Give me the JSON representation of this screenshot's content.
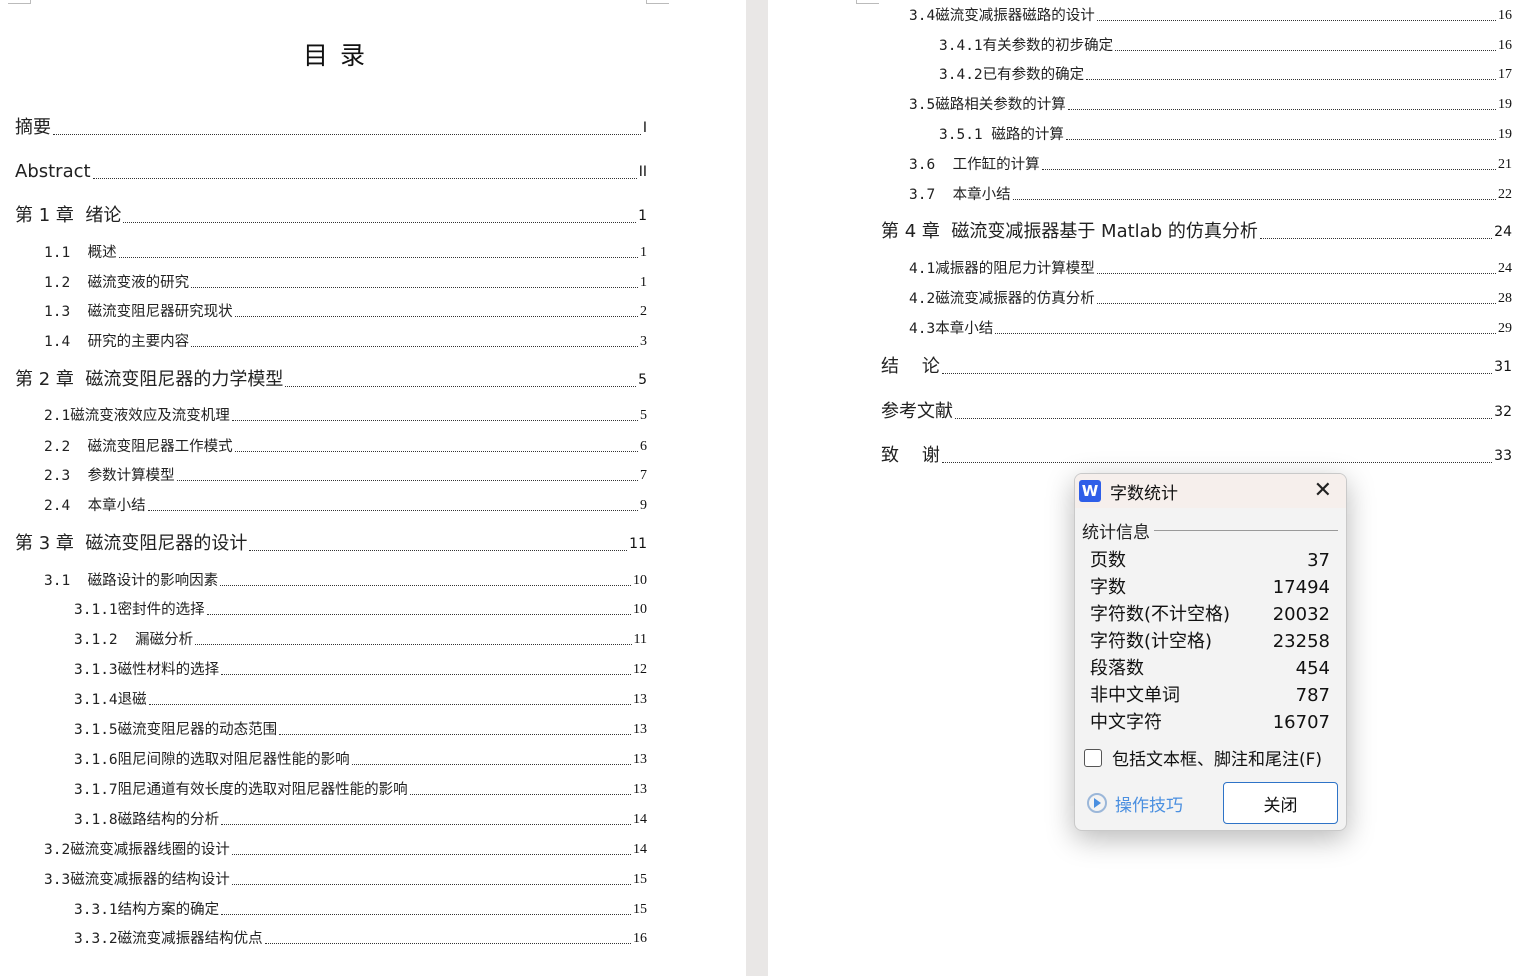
{
  "document": {
    "title": "目  录",
    "left_entries": [
      {
        "text": "摘要",
        "page": "I"
      },
      {
        "text": "Abstract",
        "page": "II"
      },
      {
        "text": "第 1 章  绪论",
        "page": "1"
      },
      {
        "text": "1.1  概述",
        "page": "1"
      },
      {
        "text": "1.2  磁流变液的研究",
        "page": "1"
      },
      {
        "text": "1.3  磁流变阻尼器研究现状",
        "page": "2"
      },
      {
        "text": "1.4  研究的主要内容",
        "page": "3"
      },
      {
        "text": "第 2 章  磁流变阻尼器的力学模型",
        "page": "5"
      },
      {
        "text": "2.1磁流变液效应及流变机理",
        "page": "5"
      },
      {
        "text": "2.2  磁流变阻尼器工作模式",
        "page": "6"
      },
      {
        "text": "2.3  参数计算模型",
        "page": "7"
      },
      {
        "text": "2.4  本章小结",
        "page": "9"
      },
      {
        "text": "第 3 章  磁流变阻尼器的设计",
        "page": "11"
      },
      {
        "text": "3.1  磁路设计的影响因素",
        "page": "10"
      },
      {
        "text": "3.1.1密封件的选择",
        "page": "10"
      },
      {
        "text": "3.1.2  漏磁分析",
        "page": "11"
      },
      {
        "text": "3.1.3磁性材料的选择",
        "page": "12"
      },
      {
        "text": "3.1.4退磁",
        "page": "13"
      },
      {
        "text": "3.1.5磁流变阻尼器的动态范围",
        "page": "13"
      },
      {
        "text": "3.1.6阻尼间隙的选取对阻尼器性能的影响",
        "page": "13"
      },
      {
        "text": "3.1.7阻尼通道有效长度的选取对阻尼器性能的影响",
        "page": "13"
      },
      {
        "text": "3.1.8磁路结构的分析",
        "page": "14"
      },
      {
        "text": "3.2磁流变减振器线圈的设计",
        "page": "14"
      },
      {
        "text": "3.3磁流变减振器的结构设计",
        "page": "15"
      },
      {
        "text": "3.3.1结构方案的确定",
        "page": "15"
      },
      {
        "text": "3.3.2磁流变减振器结构优点",
        "page": "16"
      }
    ],
    "right_entries": [
      {
        "text": "3.4磁流变减振器磁路的设计",
        "page": "16"
      },
      {
        "text": "3.4.1有关参数的初步确定",
        "page": "16"
      },
      {
        "text": "3.4.2已有参数的确定",
        "page": "17"
      },
      {
        "text": "3.5磁路相关参数的计算",
        "page": "19"
      },
      {
        "text": "3.5.1 磁路的计算",
        "page": "19"
      },
      {
        "text": "3.6  工作缸的计算",
        "page": "21"
      },
      {
        "text": "3.7  本章小结",
        "page": "22"
      },
      {
        "text": "第 4 章  磁流变减振器基于 Matlab 的仿真分析",
        "page": "24"
      },
      {
        "text": "4.1减振器的阻尼力计算模型",
        "page": "24"
      },
      {
        "text": "4.2磁流变减振器的仿真分析",
        "page": "28"
      },
      {
        "text": "4.3本章小结",
        "page": "29"
      },
      {
        "text": "结    论",
        "page": "31"
      },
      {
        "text": "参考文献",
        "page": "32"
      },
      {
        "text": "致    谢",
        "page": "33"
      }
    ]
  },
  "dialog": {
    "app_icon_letter": "W",
    "title": "字数统计",
    "section": "统计信息",
    "stats": [
      {
        "label": "页数",
        "value": "37"
      },
      {
        "label": "字数",
        "value": "17494"
      },
      {
        "label": "字符数(不计空格)",
        "value": "20032"
      },
      {
        "label": "字符数(计空格)",
        "value": "23258"
      },
      {
        "label": "段落数",
        "value": "454"
      },
      {
        "label": "非中文单词",
        "value": "787"
      },
      {
        "label": "中文字符",
        "value": "16707"
      }
    ],
    "checkbox_label": "包括文本框、脚注和尾注(F)",
    "checkbox_checked": false,
    "tips_label": "操作技巧",
    "close_label": "关闭",
    "accent": "#2e73c7"
  }
}
